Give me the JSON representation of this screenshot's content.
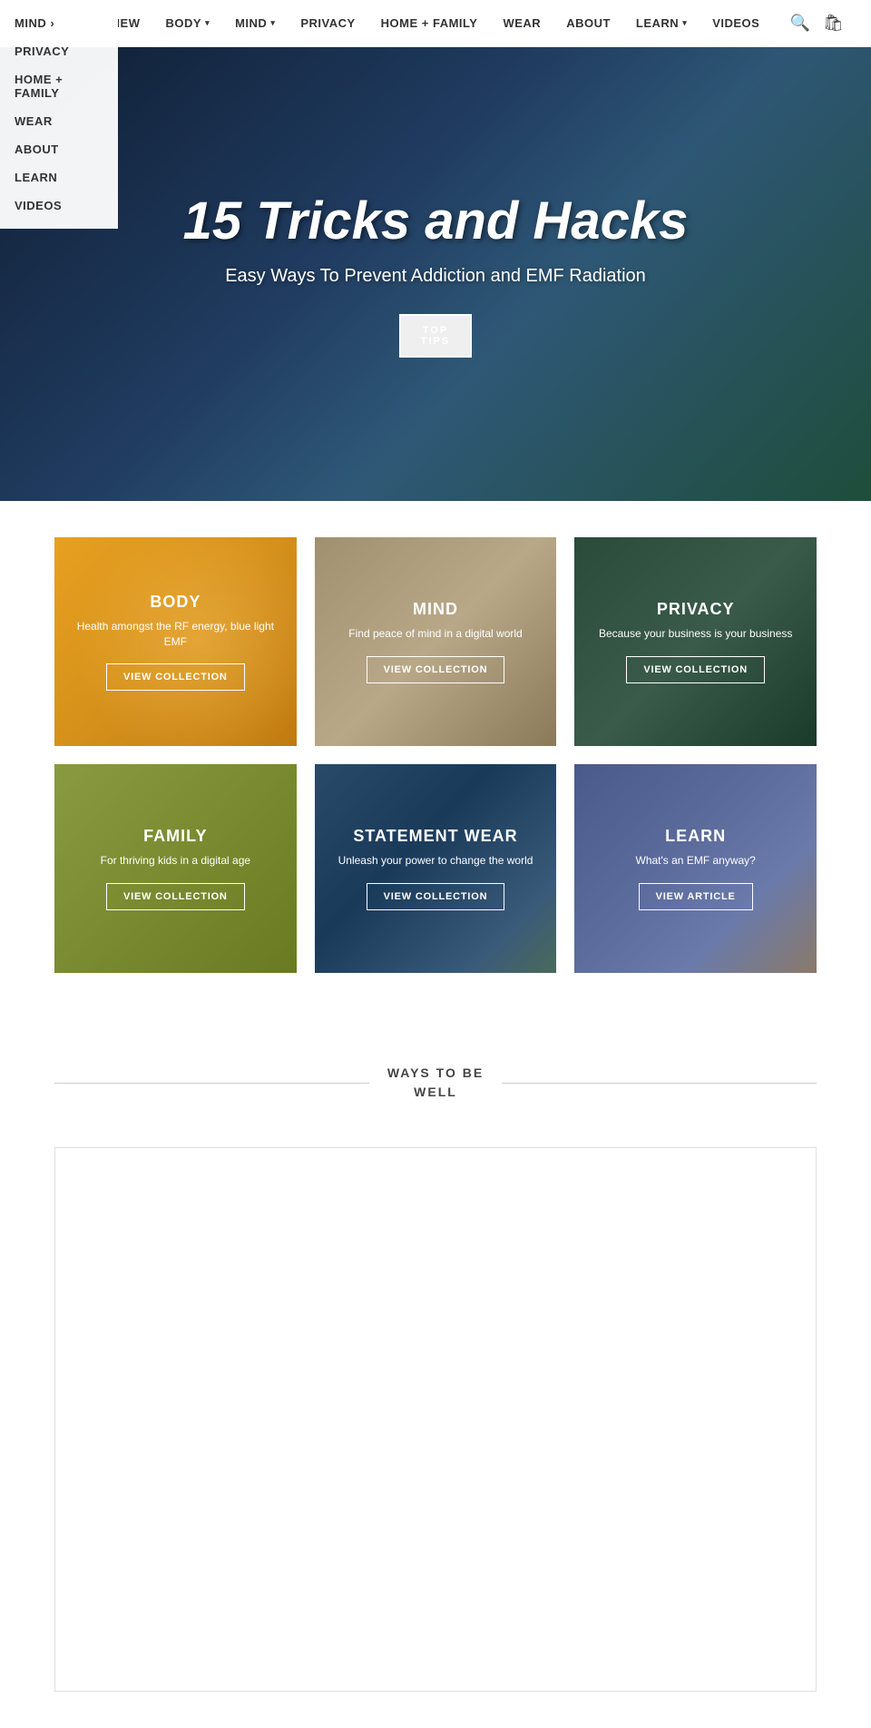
{
  "mobile_menu": {
    "items": [
      {
        "label": "MIND",
        "has_arrow": true
      },
      {
        "label": "PRIVACY",
        "has_arrow": false
      },
      {
        "label": "HOME + FAMILY",
        "has_arrow": false
      },
      {
        "label": "WEAR",
        "has_arrow": false
      },
      {
        "label": "ABOUT",
        "has_arrow": false
      },
      {
        "label": "LEARN",
        "has_arrow": false
      },
      {
        "label": "VIDEOS",
        "has_arrow": false
      }
    ]
  },
  "nav": {
    "links": [
      {
        "label": "NEW",
        "has_dropdown": false
      },
      {
        "label": "BODY",
        "has_dropdown": true
      },
      {
        "label": "MIND",
        "has_dropdown": true
      },
      {
        "label": "PRIVACY",
        "has_dropdown": false
      },
      {
        "label": "HOME + FAMILY",
        "has_dropdown": false
      },
      {
        "label": "WEAR",
        "has_dropdown": false
      },
      {
        "label": "ABOUT",
        "has_dropdown": false
      },
      {
        "label": "LEARN",
        "has_dropdown": true
      },
      {
        "label": "VIDEOS",
        "has_dropdown": false
      }
    ]
  },
  "hero": {
    "title": "15 Tricks and Hacks",
    "subtitle": "Easy Ways To Prevent Addiction and EMF Radiation",
    "btn_line1": "TOP",
    "btn_line2": "TIPS"
  },
  "grid": {
    "cards": [
      {
        "id": "body",
        "title": "BODY",
        "desc": "Health amongst the RF energy, blue light EMF",
        "btn": "VIEW COLLECTION",
        "bg_class": "bg-body"
      },
      {
        "id": "mind",
        "title": "MIND",
        "desc": "Find peace of mind in a digital world",
        "btn": "VIEW COLLECTION",
        "bg_class": "bg-mind"
      },
      {
        "id": "privacy",
        "title": "PRIVACY",
        "desc": "Because your business is your business",
        "btn": "VIEW COLLECTION",
        "bg_class": "bg-privacy"
      },
      {
        "id": "family",
        "title": "FAMILY",
        "desc": "For thriving kids in a digital age",
        "btn": "VIEW COLLECTION",
        "bg_class": "bg-family"
      },
      {
        "id": "wear",
        "title": "STATEMENT WEAR",
        "desc": "Unleash your power to change the world",
        "btn": "VIEW COLLECTION",
        "bg_class": "bg-wear"
      },
      {
        "id": "learn",
        "title": "LEARN",
        "desc": "What's an EMF anyway?",
        "btn": "VIEW ARTICLE",
        "bg_class": "bg-learn"
      }
    ]
  },
  "ways_section": {
    "title_line1": "WAYS TO BE",
    "title_line2": "WELL"
  }
}
